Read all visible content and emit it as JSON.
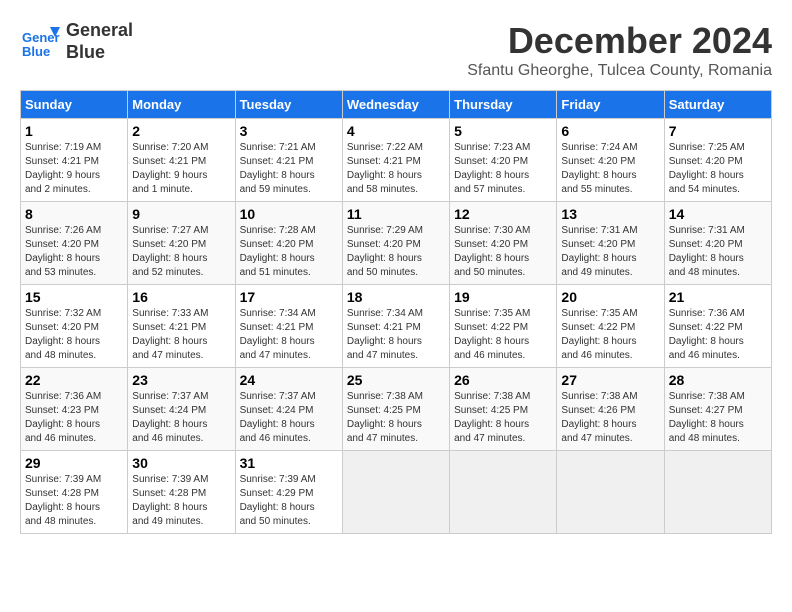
{
  "header": {
    "logo_line1": "General",
    "logo_line2": "Blue",
    "title": "December 2024",
    "subtitle": "Sfantu Gheorghe, Tulcea County, Romania"
  },
  "days_of_week": [
    "Sunday",
    "Monday",
    "Tuesday",
    "Wednesday",
    "Thursday",
    "Friday",
    "Saturday"
  ],
  "weeks": [
    [
      {
        "day": 1,
        "info": "Sunrise: 7:19 AM\nSunset: 4:21 PM\nDaylight: 9 hours\nand 2 minutes."
      },
      {
        "day": 2,
        "info": "Sunrise: 7:20 AM\nSunset: 4:21 PM\nDaylight: 9 hours\nand 1 minute."
      },
      {
        "day": 3,
        "info": "Sunrise: 7:21 AM\nSunset: 4:21 PM\nDaylight: 8 hours\nand 59 minutes."
      },
      {
        "day": 4,
        "info": "Sunrise: 7:22 AM\nSunset: 4:21 PM\nDaylight: 8 hours\nand 58 minutes."
      },
      {
        "day": 5,
        "info": "Sunrise: 7:23 AM\nSunset: 4:20 PM\nDaylight: 8 hours\nand 57 minutes."
      },
      {
        "day": 6,
        "info": "Sunrise: 7:24 AM\nSunset: 4:20 PM\nDaylight: 8 hours\nand 55 minutes."
      },
      {
        "day": 7,
        "info": "Sunrise: 7:25 AM\nSunset: 4:20 PM\nDaylight: 8 hours\nand 54 minutes."
      }
    ],
    [
      {
        "day": 8,
        "info": "Sunrise: 7:26 AM\nSunset: 4:20 PM\nDaylight: 8 hours\nand 53 minutes."
      },
      {
        "day": 9,
        "info": "Sunrise: 7:27 AM\nSunset: 4:20 PM\nDaylight: 8 hours\nand 52 minutes."
      },
      {
        "day": 10,
        "info": "Sunrise: 7:28 AM\nSunset: 4:20 PM\nDaylight: 8 hours\nand 51 minutes."
      },
      {
        "day": 11,
        "info": "Sunrise: 7:29 AM\nSunset: 4:20 PM\nDaylight: 8 hours\nand 50 minutes."
      },
      {
        "day": 12,
        "info": "Sunrise: 7:30 AM\nSunset: 4:20 PM\nDaylight: 8 hours\nand 50 minutes."
      },
      {
        "day": 13,
        "info": "Sunrise: 7:31 AM\nSunset: 4:20 PM\nDaylight: 8 hours\nand 49 minutes."
      },
      {
        "day": 14,
        "info": "Sunrise: 7:31 AM\nSunset: 4:20 PM\nDaylight: 8 hours\nand 48 minutes."
      }
    ],
    [
      {
        "day": 15,
        "info": "Sunrise: 7:32 AM\nSunset: 4:20 PM\nDaylight: 8 hours\nand 48 minutes."
      },
      {
        "day": 16,
        "info": "Sunrise: 7:33 AM\nSunset: 4:21 PM\nDaylight: 8 hours\nand 47 minutes."
      },
      {
        "day": 17,
        "info": "Sunrise: 7:34 AM\nSunset: 4:21 PM\nDaylight: 8 hours\nand 47 minutes."
      },
      {
        "day": 18,
        "info": "Sunrise: 7:34 AM\nSunset: 4:21 PM\nDaylight: 8 hours\nand 47 minutes."
      },
      {
        "day": 19,
        "info": "Sunrise: 7:35 AM\nSunset: 4:22 PM\nDaylight: 8 hours\nand 46 minutes."
      },
      {
        "day": 20,
        "info": "Sunrise: 7:35 AM\nSunset: 4:22 PM\nDaylight: 8 hours\nand 46 minutes."
      },
      {
        "day": 21,
        "info": "Sunrise: 7:36 AM\nSunset: 4:22 PM\nDaylight: 8 hours\nand 46 minutes."
      }
    ],
    [
      {
        "day": 22,
        "info": "Sunrise: 7:36 AM\nSunset: 4:23 PM\nDaylight: 8 hours\nand 46 minutes."
      },
      {
        "day": 23,
        "info": "Sunrise: 7:37 AM\nSunset: 4:24 PM\nDaylight: 8 hours\nand 46 minutes."
      },
      {
        "day": 24,
        "info": "Sunrise: 7:37 AM\nSunset: 4:24 PM\nDaylight: 8 hours\nand 46 minutes."
      },
      {
        "day": 25,
        "info": "Sunrise: 7:38 AM\nSunset: 4:25 PM\nDaylight: 8 hours\nand 47 minutes."
      },
      {
        "day": 26,
        "info": "Sunrise: 7:38 AM\nSunset: 4:25 PM\nDaylight: 8 hours\nand 47 minutes."
      },
      {
        "day": 27,
        "info": "Sunrise: 7:38 AM\nSunset: 4:26 PM\nDaylight: 8 hours\nand 47 minutes."
      },
      {
        "day": 28,
        "info": "Sunrise: 7:38 AM\nSunset: 4:27 PM\nDaylight: 8 hours\nand 48 minutes."
      }
    ],
    [
      {
        "day": 29,
        "info": "Sunrise: 7:39 AM\nSunset: 4:28 PM\nDaylight: 8 hours\nand 48 minutes."
      },
      {
        "day": 30,
        "info": "Sunrise: 7:39 AM\nSunset: 4:28 PM\nDaylight: 8 hours\nand 49 minutes."
      },
      {
        "day": 31,
        "info": "Sunrise: 7:39 AM\nSunset: 4:29 PM\nDaylight: 8 hours\nand 50 minutes."
      },
      null,
      null,
      null,
      null
    ]
  ]
}
